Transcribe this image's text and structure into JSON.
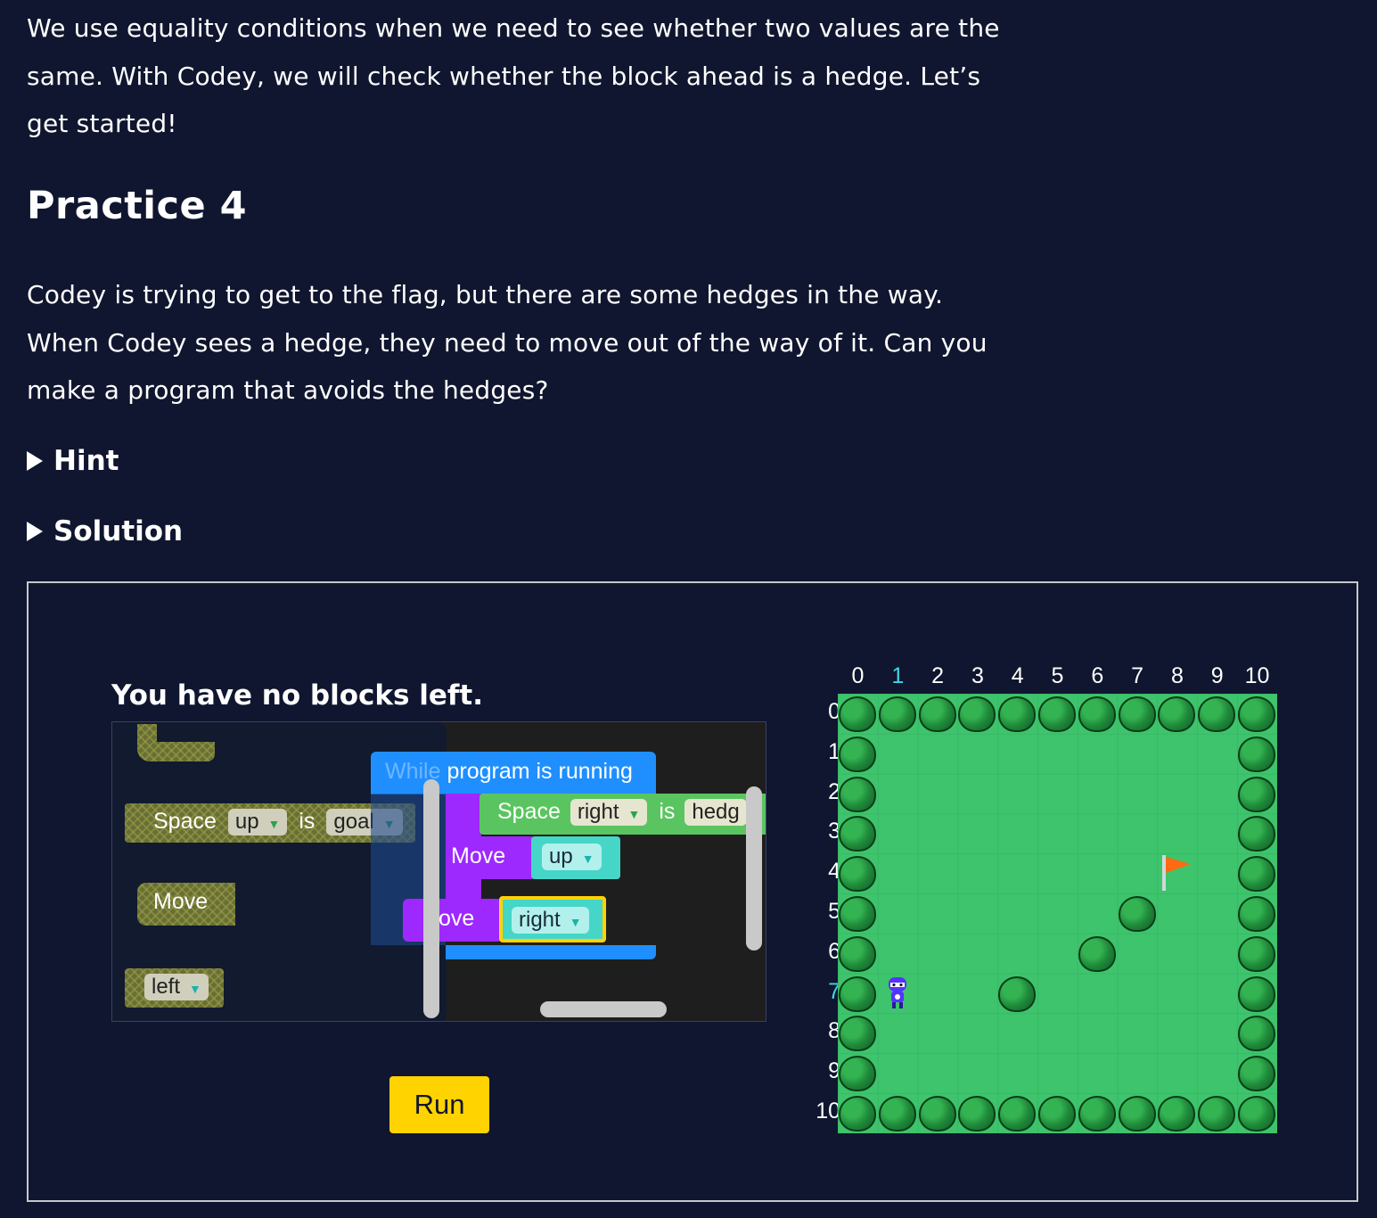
{
  "intro": "We use equality conditions when we need to see whether two values are the same. With Codey, we will check whether the block ahead is a hedge. Let’s get started!",
  "practice_title": "Practice 4",
  "task": "Codey is trying to get to the flag, but there are some hedges in the way. When Codey sees a hedge, they need to move out of the way of it. Can you make a program that avoids the hedges?",
  "hint_label": "Hint",
  "solution_label": "Solution",
  "blocks_left_label": "You have no blocks left.",
  "toolbox": {
    "condition": {
      "space": "Space",
      "dir": "up",
      "is": "is",
      "target": "goal"
    },
    "move": "Move",
    "direction": "left"
  },
  "program": {
    "while_prefix": "While",
    "while_label": "program is running",
    "cond_space": "Space",
    "cond_dir": "right",
    "cond_is": "is",
    "cond_target": "hedg",
    "move1": "Move",
    "move1_dir": "up",
    "move2": "ove",
    "move2_dir": "right"
  },
  "run_label": "Run",
  "grid": {
    "col_labels": [
      "0",
      "1",
      "2",
      "3",
      "4",
      "5",
      "6",
      "7",
      "8",
      "9",
      "10"
    ],
    "row_labels": [
      "0",
      "1",
      "2",
      "3",
      "4",
      "5",
      "6",
      "7",
      "8",
      "9",
      "10"
    ],
    "highlight_col": "1",
    "highlight_row": "7",
    "interior_hedges": [
      [
        7,
        5
      ],
      [
        6,
        6
      ],
      [
        4,
        7
      ]
    ],
    "codey": [
      1,
      7
    ],
    "flag": [
      8,
      4
    ]
  },
  "colors": {
    "background": "#10162f",
    "run_button": "#ffd300",
    "while_block": "#1f8fff",
    "condition_block": "#5ac560",
    "move_block": "#9d29ff",
    "direction_block": "#45d6c8",
    "grass": "#3ec46c",
    "flag": "#ff6a13",
    "codey": "#5533ff"
  }
}
